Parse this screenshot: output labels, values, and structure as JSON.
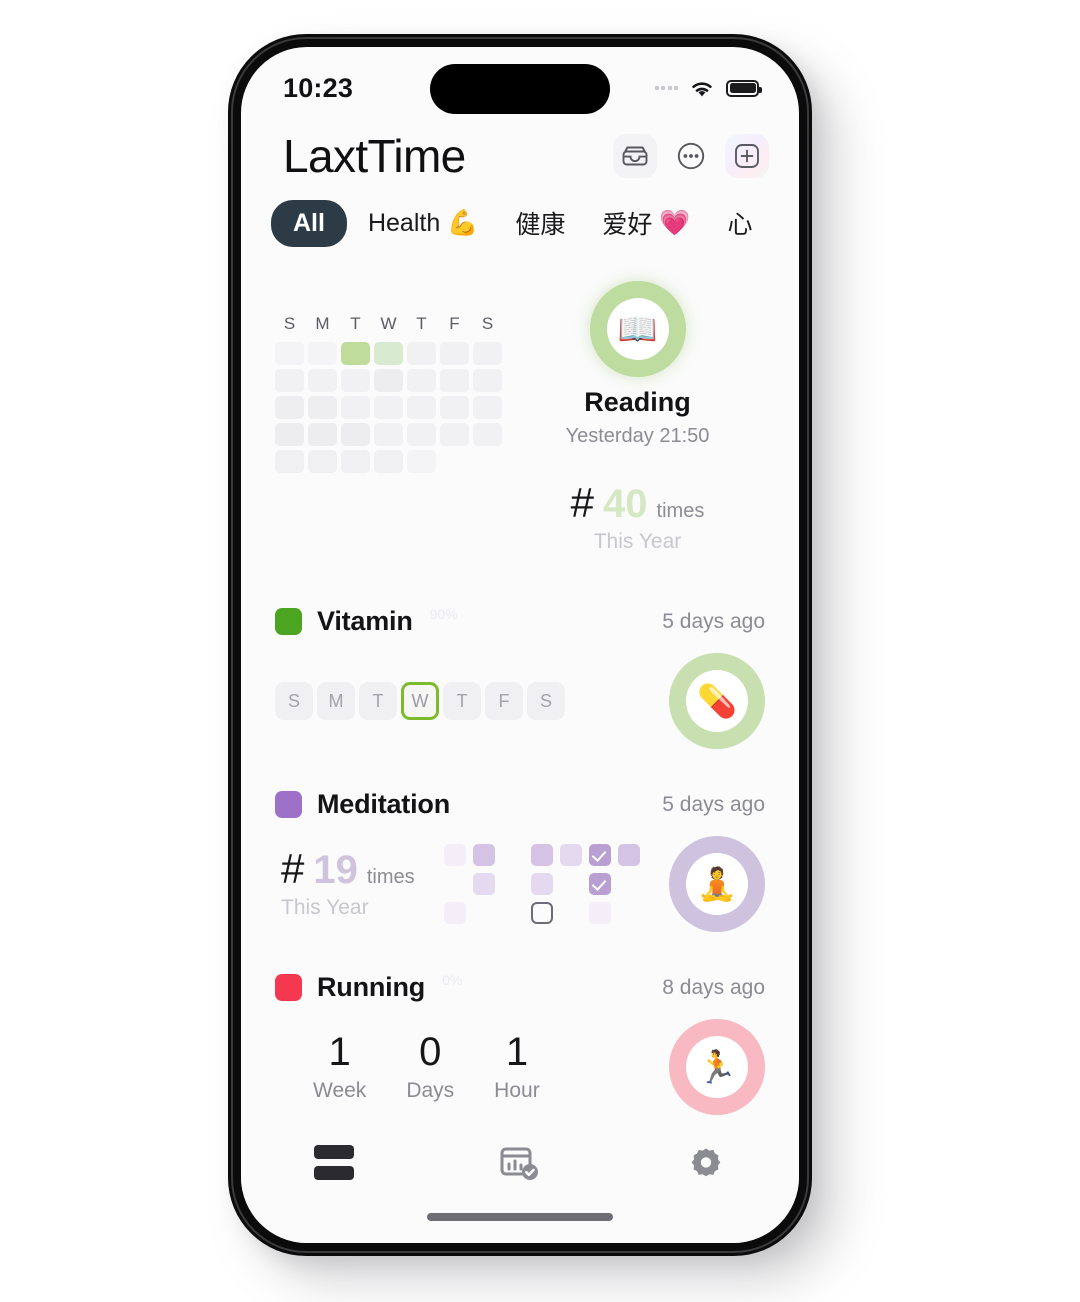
{
  "status_bar": {
    "time": "10:23",
    "signal_icon": "signal-dots-icon",
    "wifi_icon": "wifi-icon",
    "battery_icon": "battery-full-icon"
  },
  "header": {
    "app_title": "LaxtTime",
    "actions": [
      {
        "name": "archive-icon",
        "label": "Archive"
      },
      {
        "name": "more-ellipsis-icon",
        "label": "More"
      },
      {
        "name": "add-plus-icon",
        "label": "Add"
      }
    ]
  },
  "tabs": [
    {
      "label": "All",
      "emoji": "",
      "active": true
    },
    {
      "label": "Health",
      "emoji": "💪",
      "active": false
    },
    {
      "label": "健康",
      "emoji": "",
      "active": false
    },
    {
      "label": "爱好",
      "emoji": "💗",
      "active": false
    },
    {
      "label": "心",
      "emoji": "",
      "active": false
    }
  ],
  "habits": [
    {
      "id": "reading",
      "name": "Reading",
      "subtitle": "Yesterday 21:50",
      "emoji": "📖",
      "ring_color": "#bedba0",
      "accent": "#d5e8c3",
      "hash": "#",
      "count": "40",
      "count_unit": "times",
      "count_period": "This Year",
      "dow_labels": [
        "S",
        "M",
        "T",
        "W",
        "T",
        "F",
        "S"
      ],
      "heatmap": [
        [
          "#f4f4f6",
          "#f4f4f6",
          "#bfdc9b",
          "#d8ead0",
          "#f1f1f3",
          "#f1f1f3",
          "#f1f1f3"
        ],
        [
          "#f1f1f3",
          "#f1f1f3",
          "#f1f1f3",
          "#ededf0",
          "#f1f1f3",
          "#f1f1f3",
          "#f1f1f3"
        ],
        [
          "#eeeef1",
          "#eeeef1",
          "#f1f1f3",
          "#f1f1f3",
          "#f1f1f3",
          "#f1f1f3",
          "#f1f1f3"
        ],
        [
          "#ededf0",
          "#ededf0",
          "#ededf0",
          "#f1f1f3",
          "#f1f1f3",
          "#f1f1f3",
          "#f1f1f3"
        ],
        [
          "#f0f0f2",
          "#f0f0f2",
          "#f0f0f2",
          "#f0f0f2",
          "#f4f4f6",
          "#fbfbfc",
          "#fbfbfc"
        ]
      ]
    },
    {
      "id": "vitamin",
      "name": "Vitamin",
      "badge": "90%",
      "last": "5 days ago",
      "swatch": "#4ca520",
      "emoji": "💊",
      "ring_class": "green-soft",
      "week": [
        {
          "label": "S",
          "today": false
        },
        {
          "label": "M",
          "today": false
        },
        {
          "label": "T",
          "today": false
        },
        {
          "label": "W",
          "today": true
        },
        {
          "label": "T",
          "today": false
        },
        {
          "label": "F",
          "today": false
        },
        {
          "label": "S",
          "today": false
        }
      ]
    },
    {
      "id": "meditation",
      "name": "Meditation",
      "last": "5 days ago",
      "swatch": "#9d71c7",
      "emoji": "🧘",
      "ring_class": "purple",
      "hash": "#",
      "count": "19",
      "count_unit": "times",
      "count_period": "This Year",
      "checkboxes": [
        [
          "l1",
          "l3",
          "none",
          "l3",
          "l2",
          "l4 checked",
          "l3"
        ],
        [
          "none",
          "l2",
          "none",
          "l2",
          "none",
          "l4 checked",
          "none"
        ],
        [
          "l1",
          "none",
          "none",
          "outline",
          "none",
          "l1",
          "none"
        ]
      ]
    },
    {
      "id": "running",
      "name": "Running",
      "badge": "0%",
      "last": "8 days ago",
      "swatch": "#f5384f",
      "emoji": "🏃",
      "ring_class": "red",
      "duration": [
        {
          "value": "1",
          "unit": "Week"
        },
        {
          "value": "0",
          "unit": "Days"
        },
        {
          "value": "1",
          "unit": "Hour"
        }
      ]
    }
  ],
  "tabbar": [
    {
      "name": "list-icon",
      "active": true
    },
    {
      "name": "chart-check-icon",
      "active": false
    },
    {
      "name": "gear-icon",
      "active": false
    }
  ]
}
